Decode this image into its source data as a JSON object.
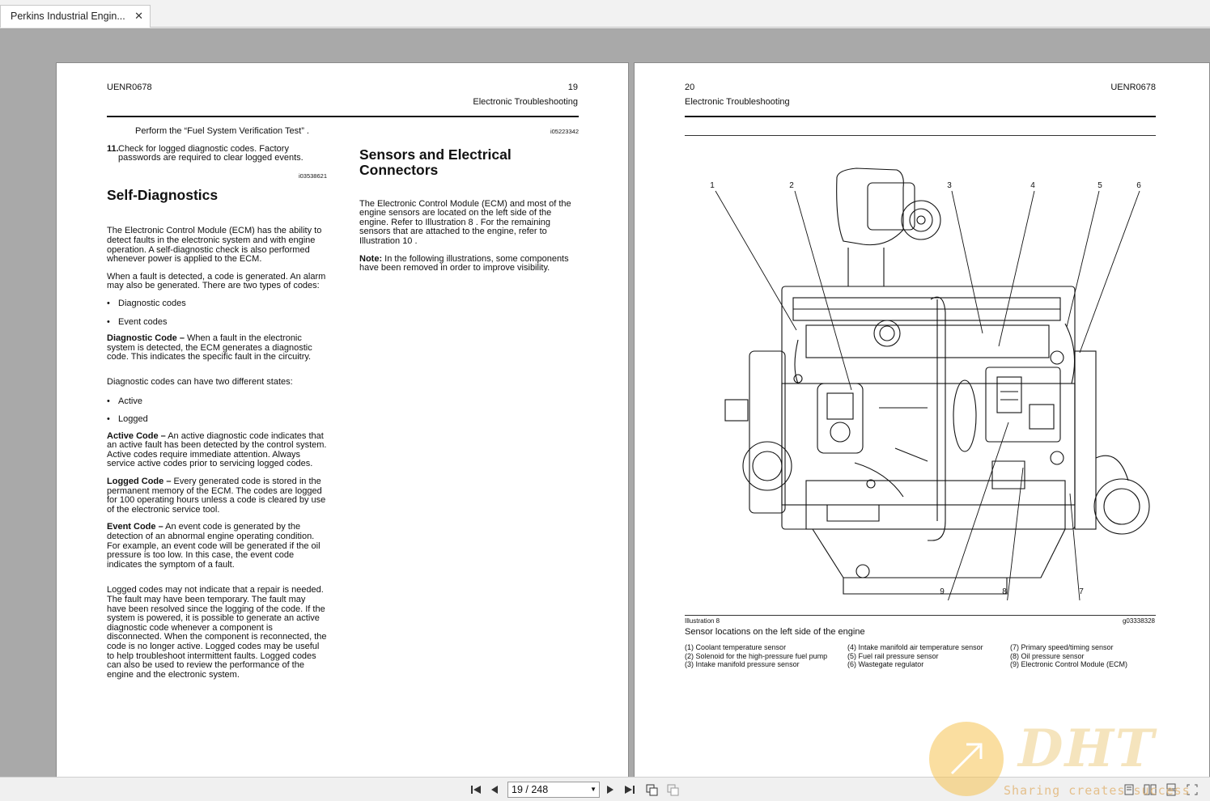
{
  "tab": {
    "title": "Perkins Industrial Engin...",
    "close": "✕"
  },
  "left_page": {
    "doc_id": "UENR0678",
    "page_no": "19",
    "section": "Electronic Troubleshooting",
    "col1": {
      "perform": "Perform the  “Fuel System Verification Test” .",
      "step11_num": "11.",
      "step11_text": "Check for logged diagnostic codes. Factory passwords are required to clear logged events.",
      "ref1": "i03538621",
      "heading": "Self-Diagnostics",
      "p1": "The Electronic Control Module (ECM) has the ability to detect faults in the electronic system and with engine operation. A self-diagnostic check is also performed whenever power is applied to the ECM.",
      "p2": "When a fault is detected, a code is generated. An alarm may also be generated. There are two types of codes:",
      "bullet1": "Diagnostic codes",
      "bullet2": "Event codes",
      "dc_term": "Diagnostic Code –",
      "dc_text": " When a fault in the electronic system is detected, the ECM generates a diagnostic code. This indicates the specific fault in the circuitry.",
      "p3": "Diagnostic codes can have two different states:",
      "bullet3": "Active",
      "bullet4": "Logged",
      "ac_term": "Active Code –",
      "ac_text": " An active diagnostic code indicates that an active fault has been detected by the control system. Active codes require immediate attention. Always service active codes prior to servicing logged codes.",
      "lc_term": "Logged Code –",
      "lc_text": " Every generated code is stored in the permanent memory of the ECM. The codes are logged for 100 operating hours unless a code is cleared by use of the electronic service tool.",
      "ec_term": "Event Code –",
      "ec_text": " An event code is generated by the detection of an abnormal engine operating condition. For example, an event code will be generated if the oil pressure is too low. In this case, the event code indicates the symptom of a fault.",
      "p4": "Logged codes may not indicate that a repair is needed. The fault may have been temporary. The fault may have been resolved since the logging of the code. If the system is powered, it is possible to generate an active diagnostic code whenever a component is disconnected. When the component is reconnected, the code is no longer active. Logged codes may be useful to help troubleshoot intermittent faults. Logged codes can also be used to review the performance of the engine and the electronic system."
    },
    "col2": {
      "ref2": "i05223342",
      "heading": "Sensors and Electrical Connectors",
      "p1": "The Electronic Control Module (ECM) and most of the engine sensors are located on the left side of the engine. Refer to Illustration 8 . For the remaining sensors that are attached to the engine, refer to Illustration 10 .",
      "note_term": "Note:",
      "note_text": " In the following illustrations, some components have been removed in order to improve visibility."
    }
  },
  "right_page": {
    "page_no": "20",
    "doc_id": "UENR0678",
    "section": "Electronic Troubleshooting",
    "callouts": [
      "1",
      "2",
      "3",
      "4",
      "5",
      "6",
      "7",
      "8",
      "9"
    ],
    "illustration_label": "Illustration 8",
    "illustration_ref": "g03338328",
    "caption": "Sensor locations on the left side of the engine",
    "legend_col1": [
      "(1) Coolant temperature sensor",
      "(2) Solenoid for the high-pressure fuel pump",
      "(3) Intake manifold pressure sensor"
    ],
    "legend_col2": [
      "(4) Intake manifold air temperature sensor",
      "(5) Fuel rail pressure sensor",
      "(6) Wastegate regulator"
    ],
    "legend_col3": [
      "(7) Primary speed/timing sensor",
      "(8) Oil pressure sensor",
      "(9) Electronic Control Module (ECM)"
    ]
  },
  "toolbar": {
    "page_display": "19 / 248"
  },
  "watermark": {
    "brand": "DHT",
    "tagline": "Sharing creates success"
  }
}
